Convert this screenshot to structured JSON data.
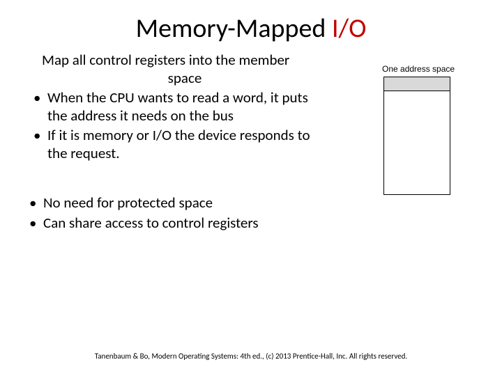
{
  "title_main": "Memory-Mapped ",
  "title_io": "I/O",
  "subtitle_l1": "Map all control registers into the member",
  "subtitle_l2": "space",
  "bullets_main": [
    "When the CPU wants to read a word, it puts the address it needs on the bus",
    "If it is memory or I/O the device responds to the request."
  ],
  "bullets_secondary": [
    "No need for protected space",
    "Can share access to control registers"
  ],
  "diagram": {
    "label": "One address space",
    "sublabel": ""
  },
  "footer": "Tanenbaum & Bo, Modern Operating Systems: 4th ed., (c) 2013 Prentice-Hall, Inc. All rights reserved."
}
